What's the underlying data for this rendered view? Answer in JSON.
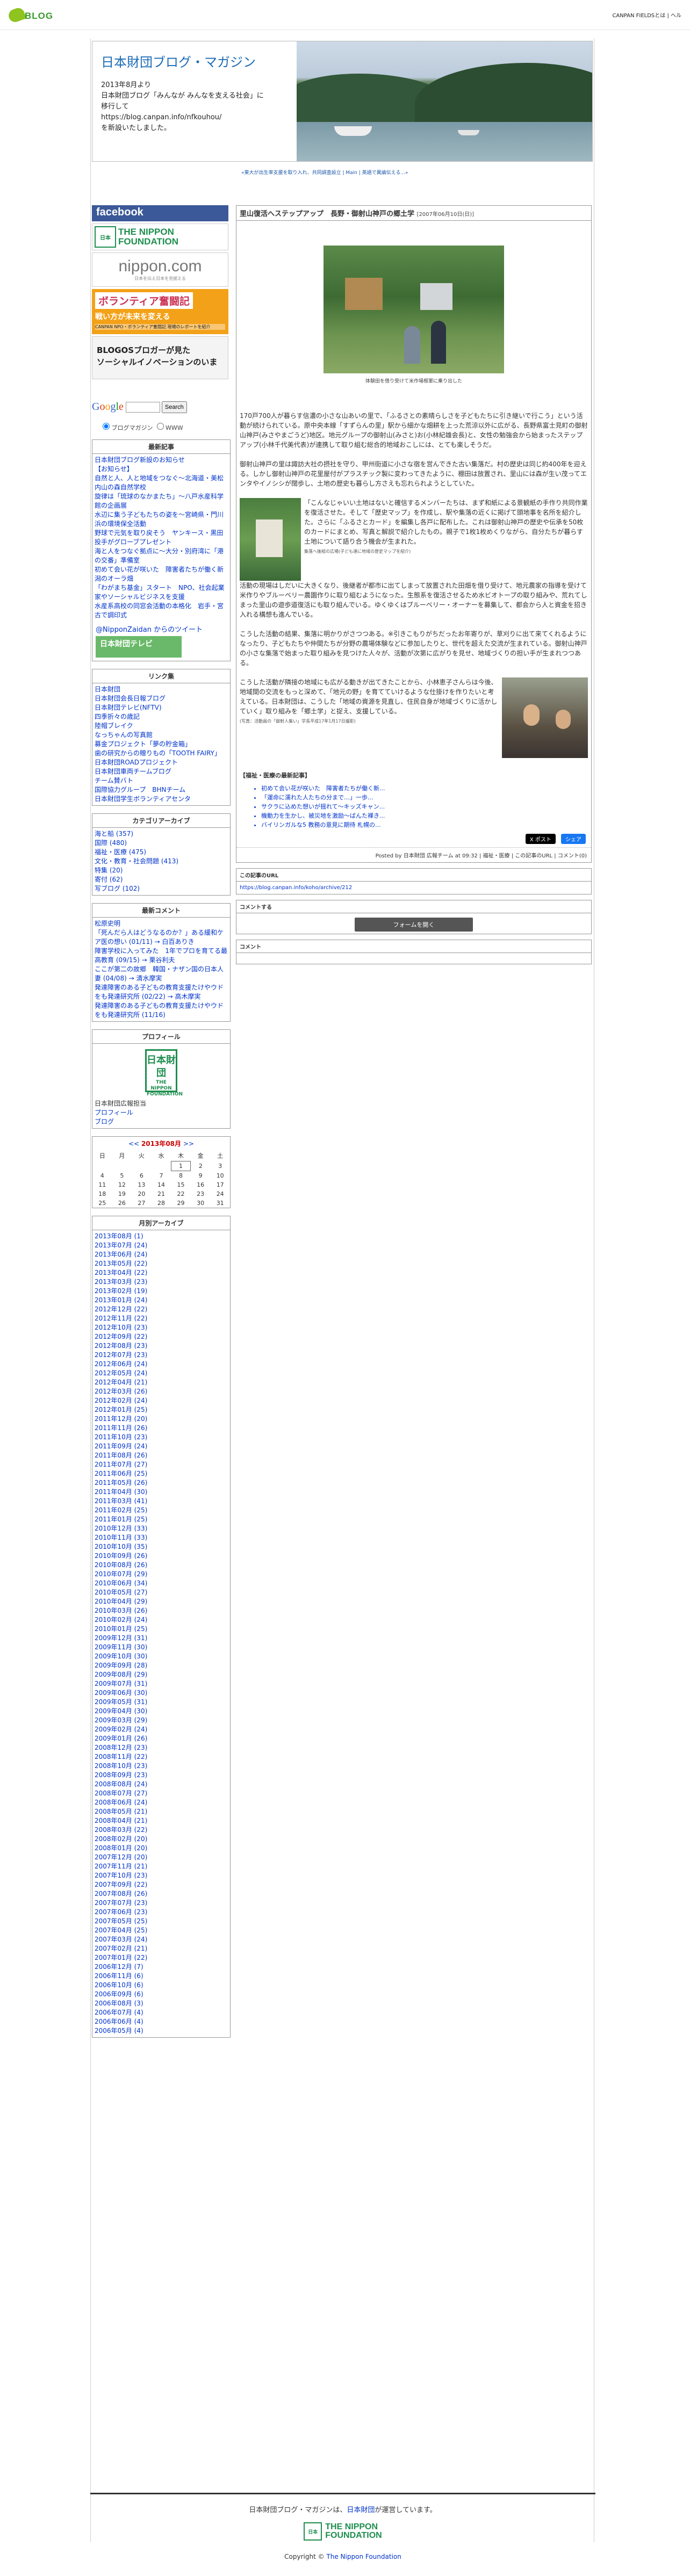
{
  "topbar": {
    "logo": "BLOG",
    "right": "CANPAN FIELDSとは | ヘル"
  },
  "header": {
    "title": "日本財団ブログ・マガジン",
    "intro": [
      "2013年8月より",
      "日本財団ブログ「みんなが みんなを支える社会」に",
      "移行して",
      "https://blog.canpan.info/nfkouhou/",
      "を新設いたしました。"
    ]
  },
  "breadcrumb": "«東大が出生率支援を取り入れ、共同調査設立 | Main | 英語で異論伝える...»",
  "sidebar": {
    "facebook": "facebook",
    "banner1": [
      "日本",
      "THE NIPPON",
      "FOUNDATION"
    ],
    "banner2": {
      "big": "nippon.com",
      "small": "日本を伝え日本を見据える"
    },
    "banner3": {
      "t1": "ボランティア奮闘記",
      "t2": "戦い方が未来を変える",
      "t3": "CANPAN NPO・ボランティア奮闘記 現場のレポートを紹介"
    },
    "banner4": [
      "BLOGOSブロガーが見た",
      "ソーシャルイノベーションのいま"
    ],
    "google": [
      "G",
      "o",
      "o",
      "g",
      "l",
      "e"
    ],
    "search_button": "Search",
    "radio1": "ブログマガジン",
    "radio2": "WWW",
    "recent_title": "最新記事",
    "recent": [
      "日本財団ブログ新設のお知らせ",
      "【お知らせ】",
      "自然と人、人と地域をつなぐ〜北海道・美松内山の森自然学校",
      "旋律は「琉球のなかまたち」〜八戸水産科学館の企画展",
      "水辺に集う子どもたちの姿を〜宮崎県・門川浜の環境保全活動",
      "野球で元気を取り戻そう　ヤンキース・黒田投手がグローブプレゼント",
      "海と人をつなぐ拠点に〜大分・別府湾に「港の交番」準備室",
      "初めて会い花が咲いた　障害者たちが働く新潟のオーラ畑",
      "「わがまち基金」スタート　NPO、社会起業家やソーシャルビジネスを支援",
      "水産系高校の同窓会活動の本格化　岩手・宮古で調印式"
    ],
    "twitter": "@NipponZaidan からのツイート",
    "tv_banner": "日本財団テレビ",
    "links_title": "リンク集",
    "links": [
      "日本財団",
      "日本財団会長日報ブログ",
      "日本財団テレビ(NFTV)",
      "四季折々の歳記",
      "陸帽ブレイク",
      "なっちゃんの写真館",
      "募金プロジェクト「夢の貯金箱」",
      "歯の研究からの贈りもの「TOOTH FAIRY」",
      "日本財団ROADプロジェクト",
      "日本財団車両チームブログ",
      "チーム賛バト",
      "国際協力グループ　BHNチーム",
      "日本財団学生ボランティアセンタ"
    ],
    "category_title": "カテゴリアーカイブ",
    "categories": [
      "海と船 (357)",
      "国際 (480)",
      "福祉・医療 (475)",
      "文化・教育・社会問題 (413)",
      "特集 (20)",
      "寄付 (62)",
      "写ブログ (102)"
    ],
    "comments_title": "最新コメント",
    "comments": [
      "松原史明",
      "「死んだら人はどうなるのか？」ある緩和ケア医の想い (01/11) → 白百ありき",
      "障害学校に入ってみた　1年でプロを育てる最高教育 (09/15) → 栗谷利夫",
      "ここが第二の故郷　韓国・ナザン国の日本人妻 (04/08) → 清水摩実",
      "発達障害のある子どもの教育支援たけやウドをも発達研究所 (02/22) → 高木摩実",
      "発達障害のある子どもの教育支援たけやウドをも発達研究所 (11/16)"
    ],
    "profile_title": "プロフィール",
    "profile_logo": "日本財団",
    "profile_logo_en": "THE NIPPON FOUNDATION",
    "profile_lines": [
      "日本財団広報担当",
      "プロフィール",
      "ブログ"
    ],
    "calendar": {
      "month": "2013年08月",
      "head": [
        "日",
        "月",
        "火",
        "水",
        "木",
        "金",
        "土"
      ],
      "rows": [
        [
          "",
          "",
          "",
          "",
          "1",
          "2",
          "3"
        ],
        [
          "4",
          "5",
          "6",
          "7",
          "8",
          "9",
          "10"
        ],
        [
          "11",
          "12",
          "13",
          "14",
          "15",
          "16",
          "17"
        ],
        [
          "18",
          "19",
          "20",
          "21",
          "22",
          "23",
          "24"
        ],
        [
          "25",
          "26",
          "27",
          "28",
          "29",
          "30",
          "31"
        ]
      ]
    },
    "archive_title": "月別アーカイブ",
    "archive": [
      "2013年08月 (1)",
      "2013年07月 (24)",
      "2013年06月 (24)",
      "2013年05月 (22)",
      "2013年04月 (22)",
      "2013年03月 (23)",
      "2013年02月 (19)",
      "2013年01月 (24)",
      "2012年12月 (22)",
      "2012年11月 (22)",
      "2012年10月 (23)",
      "2012年09月 (22)",
      "2012年08月 (23)",
      "2012年07月 (23)",
      "2012年06月 (24)",
      "2012年05月 (24)",
      "2012年04月 (21)",
      "2012年03月 (26)",
      "2012年02月 (24)",
      "2012年01月 (25)",
      "2011年12月 (20)",
      "2011年11月 (26)",
      "2011年10月 (23)",
      "2011年09月 (24)",
      "2011年08月 (26)",
      "2011年07月 (27)",
      "2011年06月 (25)",
      "2011年05月 (26)",
      "2011年04月 (30)",
      "2011年03月 (41)",
      "2011年02月 (25)",
      "2011年01月 (25)",
      "2010年12月 (33)",
      "2010年11月 (33)",
      "2010年10月 (35)",
      "2010年09月 (26)",
      "2010年08月 (26)",
      "2010年07月 (29)",
      "2010年06月 (34)",
      "2010年05月 (27)",
      "2010年04月 (29)",
      "2010年03月 (26)",
      "2010年02月 (24)",
      "2010年01月 (25)",
      "2009年12月 (31)",
      "2009年11月 (30)",
      "2009年10月 (30)",
      "2009年09月 (28)",
      "2009年08月 (29)",
      "2009年07月 (31)",
      "2009年06月 (30)",
      "2009年05月 (31)",
      "2009年04月 (30)",
      "2009年03月 (29)",
      "2009年02月 (24)",
      "2009年01月 (26)",
      "2008年12月 (23)",
      "2008年11月 (22)",
      "2008年10月 (23)",
      "2008年09月 (23)",
      "2008年08月 (24)",
      "2008年07月 (27)",
      "2008年06月 (24)",
      "2008年05月 (21)",
      "2008年04月 (21)",
      "2008年03月 (22)",
      "2008年02月 (20)",
      "2008年01月 (20)",
      "2007年12月 (20)",
      "2007年11月 (21)",
      "2007年10月 (23)",
      "2007年09月 (22)",
      "2007年08月 (26)",
      "2007年07月 (23)",
      "2007年06月 (23)",
      "2007年05月 (25)",
      "2007年04月 (25)",
      "2007年03月 (24)",
      "2007年02月 (21)",
      "2007年01月 (22)",
      "2006年12月 (7)",
      "2006年11月 (6)",
      "2006年10月 (6)",
      "2006年09月 (6)",
      "2006年08月 (3)",
      "2006年07月 (4)",
      "2006年06月 (4)",
      "2006年05月 (4)"
    ]
  },
  "post": {
    "title": "里山復活へステップアップ　長野・御射山神戸の郷土学",
    "date": "[2007年06月10日(日)]",
    "caption1": "体験田を借り受けて米作場根軍に乗り出した",
    "p1": "170戸700人が暮らす信濃の小さな山あいの里で、「ふるさとの素晴らしさを子どもたちに引き継いで行こう」という活動が続けられている。原中央本線「すずらんの里」駅から細かな畑耕を上った荒涼以外に広がる、長野県富士見町の御射山神戸(みさやまごうど)地区。地元グループの御射山(みさと)お(小林紀雄会長)と、女性の勉強会から始まったステップアップ(小林千代美代表)が連携して取り組む総合的地域おこしには、とても楽しそうだ。",
    "p2": "御射山神戸の里は諏訪大社の摂社を守り、甲州街道に小さな宿を営んできた古い集落だ。村の歴史は同じ約400年を迎える。しかし御射山神戸の花里屋付がプラスチック製に変わってきたように、棚田は放置され、里山には森が生い茂ってエンタやイノシシが闊歩し、土地の歴史も暮らし方さえも忘れられようとしていた。",
    "p3": "「こんなじゃいい土地はないと確信するメンバーたちは、まず和紙による景観紙の手作り共同作業を復活させた。そして「歴史マップ」を作成し、駅や集落の近くに掲げて頭地事を名所を紹介した。さらに「ふるさとカード」を編集し各戸に配布した。これは御射山神戸の歴史や伝承を50枚のカードにまとめ、写真と解説で紹介したもの。親子で1枚1枚めくりながら、自分たちが暮らす土地について語り合う機会が生まれた。",
    "tinycap1": "集落へ後組の広場(子ども達に地域の歴史マップを紹介)",
    "p4": "活動の現場はしだいに大きくなり、後継者が都市に出てしまって放置された田畑を借り受けて、地元農家の指導を受けて米作りやブルーベリー農園作りに取り組むようになった。生態系を復活させるため水ビオトープの取り組みや、荒れてしまった里山の遊歩道復活にも取り組んでいる。ゆくゆくはブルーベリー・オーナーを募集して、都会から人と資金を招き入れる構想も進んでいる。",
    "p5": "こうした活動の結果、集落に明かりがさつつある。※引きこもりがちだったお年寄りが、草刈りに出て来てくれるようになったり、子どもたちや仲間たちが分野の農場体験などに参加したりと、世代を超えた交流が生まれている。御射山神戸の小さな集落で始まった取り組みを見つけた人々が、活動が次第に広がりを見せ、地域づくりの担い手が生まれつつある。",
    "p6": "こうした活動が隣接の地域にも広がる動きが出てきたことから、小林恵子さんらは今後、地域間の交流をもっと深めて、「地元の野」を育てていけるような仕掛けを作りたいと考えている。日本財団は、こうした「地域の資源を見直し、住民自身が地域づくりに活かしていく」取り組みを「郷土学」と捉え、支援している。",
    "tinycap2": "(写真：活動員の「御射人集い」学長平成17年1月17日撮影)",
    "related_head": "【福祉・医療の最新記事】",
    "related": [
      "初めて会い花が咲いた　障害者たちが働く新...",
      "「運命に濡れた人たちの分まで…」一歩...",
      "サクラに込めた想いが揺れて〜キッズキャン...",
      "機動力を生かし、被災地を激励〜ばんた裸き...",
      "バイリンガルな5 教務の意見に期待 札幌の..."
    ],
    "x_button": "X ポスト",
    "fb_button": "シェア",
    "posted": "Posted by 日本財団 広報チーム at 09:32 | 福祉・医療 | この記事のURL | コメント(0)"
  },
  "url_section": {
    "title": "この記事のURL",
    "url": "https://blog.canpan.info/koho/archive/212"
  },
  "comment_form": {
    "title": "コメントする",
    "button": "フォームを開く"
  },
  "comments_section": {
    "title": "コメント"
  },
  "footer": {
    "line1_a": "日本財団ブログ・マガジンは、",
    "line1_b": "日本財団",
    "line1_c": "が運営しています。",
    "logo1": "日本",
    "logo2": "THE NIPPON",
    "logo3": "FOUNDATION",
    "copy_a": "Copyright ©",
    "copy_b": "The Nippon Foundation"
  }
}
